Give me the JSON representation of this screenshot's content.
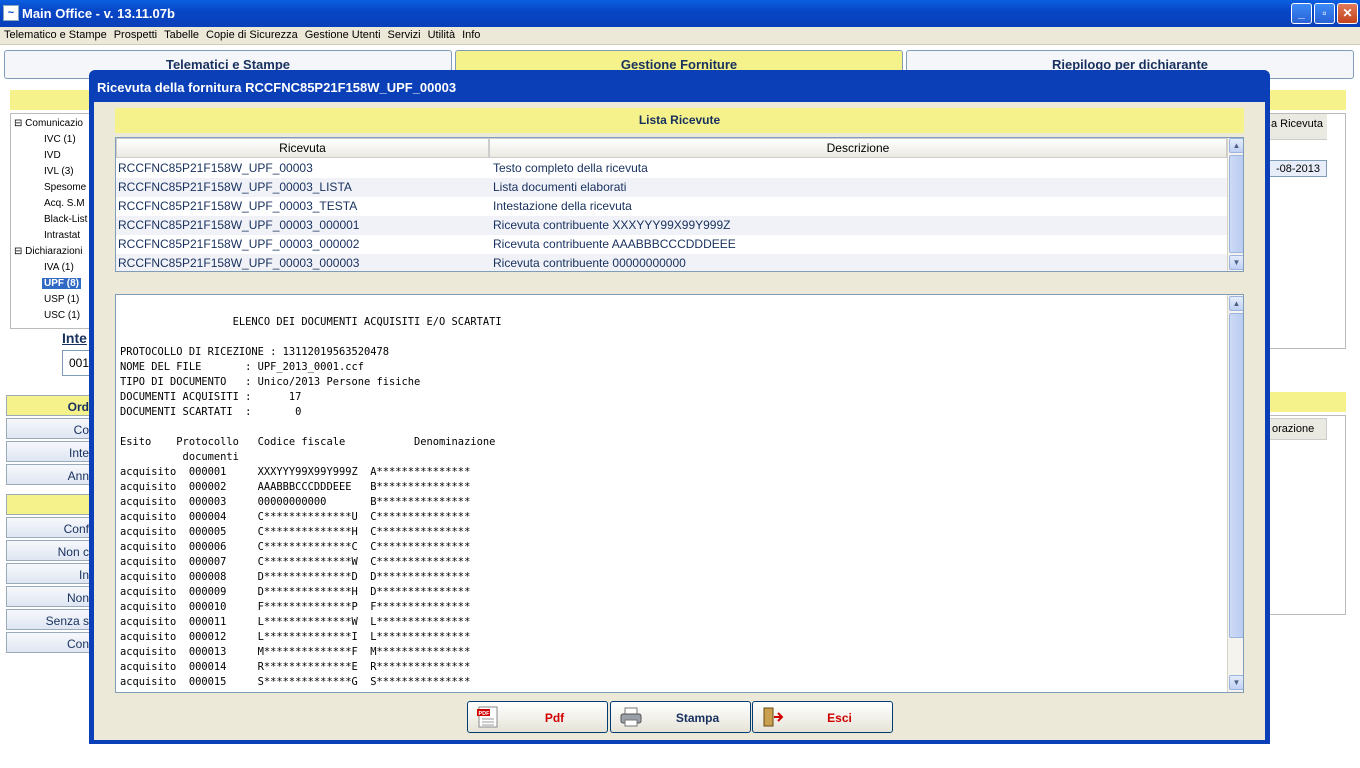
{
  "window": {
    "title": "Main Office - v. 13.11.07b",
    "controls": [
      "minimize",
      "maximize",
      "close"
    ]
  },
  "menu": [
    "Telematico e Stampe",
    "Prospetti",
    "Tabelle",
    "Copie di Sicurezza",
    "Gestione Utenti",
    "Servizi",
    "Utilità",
    "Info"
  ],
  "top_tabs": [
    "Telematici e Stampe",
    "Gestione Forniture",
    "Riepilogo per dichiarante"
  ],
  "tree": {
    "items": [
      "Comunicazio",
      "IVC (1)",
      "IVD",
      "IVL (3)",
      "Spesome",
      "Acq. S.M",
      "Black-List",
      "Intrastat",
      "Dichiarazioni",
      "IVA (1)",
      "UPF (8)",
      "USP (1)",
      "USC (1)"
    ],
    "selected": "UPF (8)"
  },
  "left_panel": {
    "intermediario_label": "Inte",
    "intermediario_value": "001",
    "buttons": [
      "Ord",
      "Co",
      "Inte",
      "Ann",
      "",
      "Conf",
      "Non c",
      "In",
      "Non",
      "Senza s",
      "Con"
    ]
  },
  "right_panel": {
    "col_header": "a Ricevuta",
    "date_value": "-08-2013",
    "col_header2": "orazione"
  },
  "dialog": {
    "title": "Ricevuta della fornitura RCCFNC85P21F158W_UPF_00003",
    "list_header": "Lista Ricevute",
    "columns": [
      "Ricevuta",
      "Descrizione"
    ],
    "rows": [
      {
        "ricevuta": "RCCFNC85P21F158W_UPF_00003",
        "descrizione": "Testo completo della ricevuta"
      },
      {
        "ricevuta": "RCCFNC85P21F158W_UPF_00003_LISTA",
        "descrizione": "Lista documenti elaborati"
      },
      {
        "ricevuta": "RCCFNC85P21F158W_UPF_00003_TESTA",
        "descrizione": "Intestazione della ricevuta"
      },
      {
        "ricevuta": "RCCFNC85P21F158W_UPF_00003_000001",
        "descrizione": "Ricevuta contribuente XXXYYY99X99Y999Z"
      },
      {
        "ricevuta": "RCCFNC85P21F158W_UPF_00003_000002",
        "descrizione": "Ricevuta contribuente AAABBBCCCDDDEEE"
      },
      {
        "ricevuta": "RCCFNC85P21F158W_UPF_00003_000003",
        "descrizione": "Ricevuta contribuente 00000000000"
      }
    ],
    "report_lines": [
      "                  ELENCO DEI DOCUMENTI ACQUISITI E/O SCARTATI",
      "",
      "PROTOCOLLO DI RICEZIONE : 13112019563520478",
      "NOME DEL FILE       : UPF_2013_0001.ccf",
      "TIPO DI DOCUMENTO   : Unico/2013 Persone fisiche",
      "DOCUMENTI ACQUISITI :      17",
      "DOCUMENTI SCARTATI  :       0",
      "",
      "Esito    Protocollo   Codice fiscale           Denominazione",
      "          documenti",
      "acquisito  000001     XXXYYY99X99Y999Z  A***************",
      "acquisito  000002     AAABBBCCCDDDEEE   B***************",
      "acquisito  000003     00000000000       B***************",
      "acquisito  000004     C**************U  C***************",
      "acquisito  000005     C**************H  C***************",
      "acquisito  000006     C**************C  C***************",
      "acquisito  000007     C**************W  C***************",
      "acquisito  000008     D**************D  D***************",
      "acquisito  000009     D**************H  D***************",
      "acquisito  000010     F**************P  F***************",
      "acquisito  000011     L**************W  L***************",
      "acquisito  000012     L**************I  L***************",
      "acquisito  000013     M**************F  M***************",
      "acquisito  000014     R**************E  R***************",
      "acquisito  000015     S**************G  S***************"
    ],
    "buttons": {
      "pdf": "Pdf",
      "stampa": "Stampa",
      "esci": "Esci"
    }
  }
}
